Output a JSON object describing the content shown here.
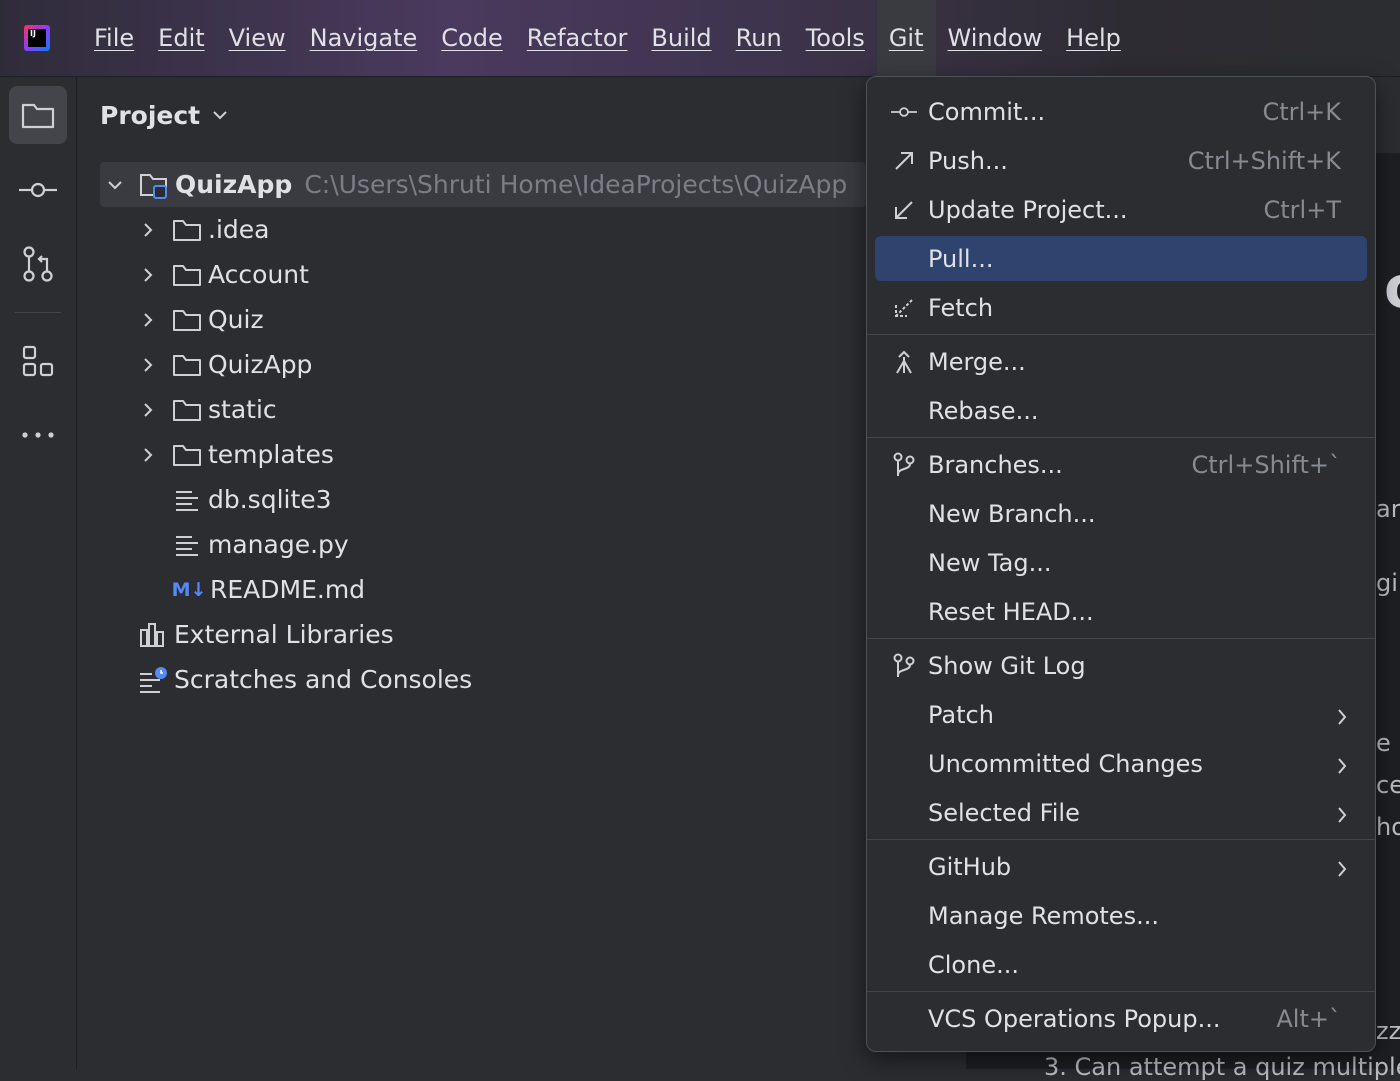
{
  "menubar": {
    "items": [
      {
        "key": "file",
        "label": "File"
      },
      {
        "key": "edit",
        "label": "Edit"
      },
      {
        "key": "view",
        "label": "View"
      },
      {
        "key": "navigate",
        "label": "Navigate"
      },
      {
        "key": "code",
        "label": "Code"
      },
      {
        "key": "refactor",
        "label": "Refactor"
      },
      {
        "key": "build",
        "label": "Build"
      },
      {
        "key": "run",
        "label": "Run"
      },
      {
        "key": "tools",
        "label": "Tools"
      },
      {
        "key": "git",
        "label": "Git",
        "active": true
      },
      {
        "key": "window",
        "label": "Window"
      },
      {
        "key": "help",
        "label": "Help"
      }
    ]
  },
  "logo_text": "IJ",
  "toolstrip": {
    "icons": [
      "folder-icon",
      "commit-icon",
      "pull-requests-icon",
      "structure-icon",
      "more-icon"
    ]
  },
  "project_panel": {
    "title": "Project",
    "root": {
      "name": "QuizApp",
      "path": "C:\\Users\\Shruti Home\\IdeaProjects\\QuizApp"
    },
    "folders": [
      ".idea",
      "Account",
      "Quiz",
      "QuizApp",
      "static",
      "templates"
    ],
    "files": [
      {
        "name": "db.sqlite3",
        "icon": "text-file-icon"
      },
      {
        "name": "manage.py",
        "icon": "text-file-icon"
      },
      {
        "name": "README.md",
        "icon": "markdown-icon",
        "badge": "M↓"
      }
    ],
    "external_libraries": "External Libraries",
    "scratches": "Scratches and Consoles"
  },
  "editor_fragments": [
    "oj",
    "ar",
    "gir",
    "e",
    "ce",
    "ho",
    "zz",
    "3. Can attempt a quiz multiple"
  ],
  "git_menu": {
    "commit": {
      "label": "Commit...",
      "shortcut": "Ctrl+K"
    },
    "push": {
      "label": "Push...",
      "shortcut": "Ctrl+Shift+K"
    },
    "update": {
      "label": "Update Project...",
      "shortcut": "Ctrl+T"
    },
    "pull": {
      "label": "Pull..."
    },
    "fetch": {
      "label": "Fetch"
    },
    "merge": {
      "label": "Merge..."
    },
    "rebase": {
      "label": "Rebase..."
    },
    "branches": {
      "label": "Branches...",
      "shortcut": "Ctrl+Shift+`"
    },
    "new_branch": {
      "label": "New Branch..."
    },
    "new_tag": {
      "label": "New Tag..."
    },
    "reset_head": {
      "label": "Reset HEAD..."
    },
    "show_log": {
      "label": "Show Git Log"
    },
    "patch": {
      "label": "Patch"
    },
    "uncommitted": {
      "label": "Uncommitted Changes"
    },
    "selected_file": {
      "label": "Selected File"
    },
    "github": {
      "label": "GitHub"
    },
    "manage_remotes": {
      "label": "Manage Remotes..."
    },
    "clone": {
      "label": "Clone..."
    },
    "vcs_popup": {
      "label": "VCS Operations Popup...",
      "shortcut": "Alt+`"
    }
  },
  "colors": {
    "background": "#2b2d30",
    "highlight": "#2e436e",
    "accent": "#548af7"
  }
}
